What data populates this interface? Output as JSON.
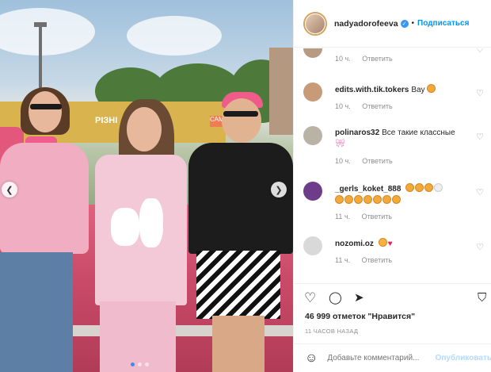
{
  "photo": {
    "billboard_text": "РІЗНІ",
    "billboard_corner": "САМИ",
    "icons": {
      "prev": "chevron-left-icon",
      "next": "chevron-right-icon"
    },
    "carousel_dots": 3,
    "active_dot": 0
  },
  "header": {
    "username": "nadyadorofeeva",
    "separator": "•",
    "follow_label": "Подписаться"
  },
  "comments": [
    {
      "user": "",
      "text": "",
      "time": "10 ч.",
      "reply": "Ответить",
      "avatar_color": "#b89a83"
    },
    {
      "user": "edits.with.tik.tokers",
      "text": "Вау",
      "emoji": "face",
      "time": "10 ч.",
      "reply": "Ответить",
      "avatar_color": "#c79a78"
    },
    {
      "user": "polinaros32",
      "text": "Все такие классные",
      "emoji": "bow",
      "time": "10 ч.",
      "reply": "Ответить",
      "avatar_color": "#b9b3a5"
    },
    {
      "user": "_gerls_koket_888",
      "text": "",
      "emoji": "faces",
      "time": "11 ч.",
      "reply": "Ответить",
      "avatar_color": "#6e3d8a"
    },
    {
      "user": "nozomi.oz",
      "text": "",
      "emoji": "cat-heart",
      "time": "11 ч.",
      "reply": "Ответить",
      "avatar_color": "#d9d9d9"
    }
  ],
  "actions": {
    "likes_text": "46 999 отметок \"Нравится\"",
    "time_text": "11 ЧАСОВ НАЗАД"
  },
  "add_comment": {
    "placeholder": "Добавьте комментарий...",
    "publish_label": "Опубликовать"
  },
  "colors": {
    "accent": "#0095f6",
    "muted": "#8e8e8e",
    "heart": "#e0245e"
  }
}
